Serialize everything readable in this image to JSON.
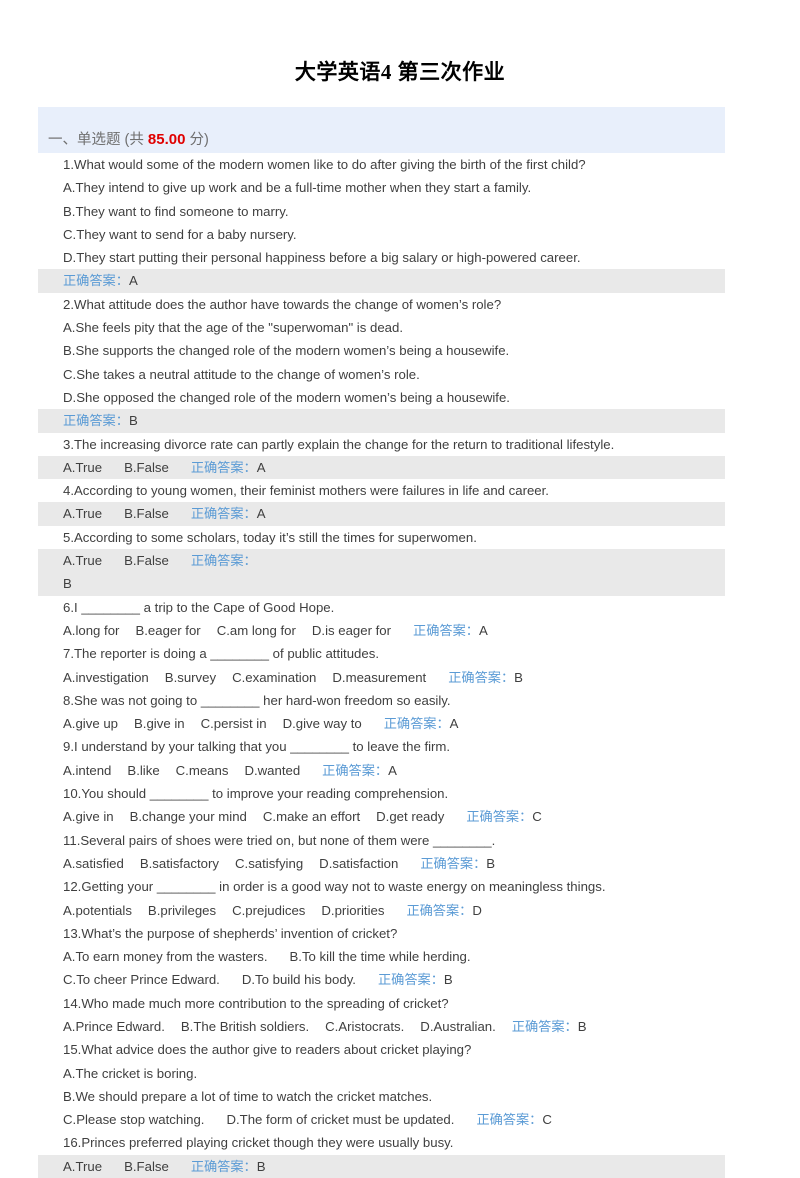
{
  "document": {
    "title": "大学英语4   第三次作业"
  },
  "section": {
    "prefix": "一、单选题 (共 ",
    "score": "85.00",
    "suffix": " 分)",
    "answer_label": "正确答案："
  },
  "questions": [
    {
      "number": "1.",
      "stem": "1.What would some of the modern women like to do after giving the birth of the first child?",
      "options": [
        "A.They intend to give up work and be a full-time mother when they start a family.",
        "B.They want to find someone to marry.",
        "C.They want to send for a baby nursery.",
        "D.They start putting their personal happiness before a big salary or high-powered career."
      ],
      "answer": "A",
      "layout": "block",
      "shaded": true
    },
    {
      "number": "2.",
      "stem": "2.What attitude does the author have towards the change of women’s role?",
      "options": [
        "A.She feels pity that the age of the \"superwoman\" is dead.",
        "B.She supports the changed role of the modern women’s being a housewife.",
        "C.She takes a neutral attitude to the change of women’s role.",
        "D.She opposed the changed role of the modern women’s being a housewife."
      ],
      "answer": "B",
      "layout": "block",
      "shaded": true
    },
    {
      "number": "3.",
      "stem": "3.The increasing divorce rate can partly explain the change for the return to traditional lifestyle.",
      "options": [
        "A.True",
        "B.False"
      ],
      "answer": "A",
      "layout": "inline",
      "shaded": true
    },
    {
      "number": "4.",
      "stem": "4.According to young women, their feminist mothers were failures in life and career.",
      "options": [
        "A.True",
        "B.False"
      ],
      "answer": "A",
      "layout": "inline",
      "shaded": true
    },
    {
      "number": "5.",
      "stem": "5.According to some scholars, today it’s still the times for superwomen.",
      "options": [
        "A.True",
        "B.False"
      ],
      "answer": "B",
      "layout": "inline-wrap",
      "shaded": true
    },
    {
      "number": "6.",
      "stem": "6.I ________ a trip to the Cape of Good Hope.",
      "options": [
        "A.long for",
        "B.eager for",
        "C.am long for",
        "D.is eager for"
      ],
      "answer": "A",
      "layout": "inline",
      "shaded": false
    },
    {
      "number": "7.",
      "stem": "7.The reporter is doing a ________ of public attitudes.",
      "options": [
        "A.investigation",
        "B.survey",
        "C.examination",
        "D.measurement"
      ],
      "answer": "B",
      "layout": "inline",
      "shaded": false
    },
    {
      "number": "8.",
      "stem": "8.She was not going to ________ her hard-won freedom so easily.",
      "options": [
        "A.give up",
        "B.give in",
        "C.persist in",
        "D.give way to"
      ],
      "answer": "A",
      "layout": "inline",
      "shaded": false
    },
    {
      "number": "9.",
      "stem": "9.I understand by your talking that you ________ to leave the firm.",
      "options": [
        "A.intend",
        "B.like",
        "C.means",
        "D.wanted"
      ],
      "answer": "A",
      "layout": "inline",
      "shaded": false
    },
    {
      "number": "10.",
      "stem": "10.You should ________ to improve your reading comprehension.",
      "options": [
        "A.give in",
        "B.change your mind",
        "C.make an effort",
        "D.get ready"
      ],
      "answer": "C",
      "layout": "inline",
      "shaded": false
    },
    {
      "number": "11.",
      "stem": "11.Several pairs of shoes were tried on, but none of them were ________.",
      "options": [
        "A.satisfied",
        "B.satisfactory",
        "C.satisfying",
        "D.satisfaction"
      ],
      "answer": "B",
      "layout": "inline",
      "shaded": false
    },
    {
      "number": "12.",
      "stem": "12.Getting your ________ in order is a good way not to waste energy on meaningless things.",
      "options": [
        "A.potentials",
        "B.privileges",
        "C.prejudices",
        "D.priorities"
      ],
      "answer": "D",
      "layout": "inline",
      "shaded": false
    },
    {
      "number": "13.",
      "stem": "13.What’s the purpose of shepherds’ invention of cricket?",
      "options": [
        "A.To earn money from the wasters.",
        "B.To kill the time while herding.",
        "C.To cheer Prince Edward.",
        "D.To build his body."
      ],
      "answer": "B",
      "layout": "two-per-row",
      "shaded": false
    },
    {
      "number": "14.",
      "stem": "14.Who made much more contribution to the spreading of cricket?",
      "options": [
        "A.Prince Edward.",
        "B.The British soldiers.",
        "C.Aristocrats.",
        "D.Australian."
      ],
      "answer": "B",
      "layout": "inline",
      "shaded": false
    },
    {
      "number": "15.",
      "stem": "15.What advice does the author give to readers about cricket playing?",
      "options": [
        "A.The cricket is boring.",
        "B.We should prepare a lot of time to watch the cricket matches.",
        "C.Please stop watching.",
        "D.The form of cricket must be updated."
      ],
      "answer": "C",
      "layout": "mixed",
      "shaded": false
    },
    {
      "number": "16.",
      "stem": "16.Princes preferred playing cricket though they were usually busy.",
      "options": [
        "A.True",
        "B.False"
      ],
      "answer": "B",
      "layout": "inline",
      "shaded": true
    }
  ]
}
